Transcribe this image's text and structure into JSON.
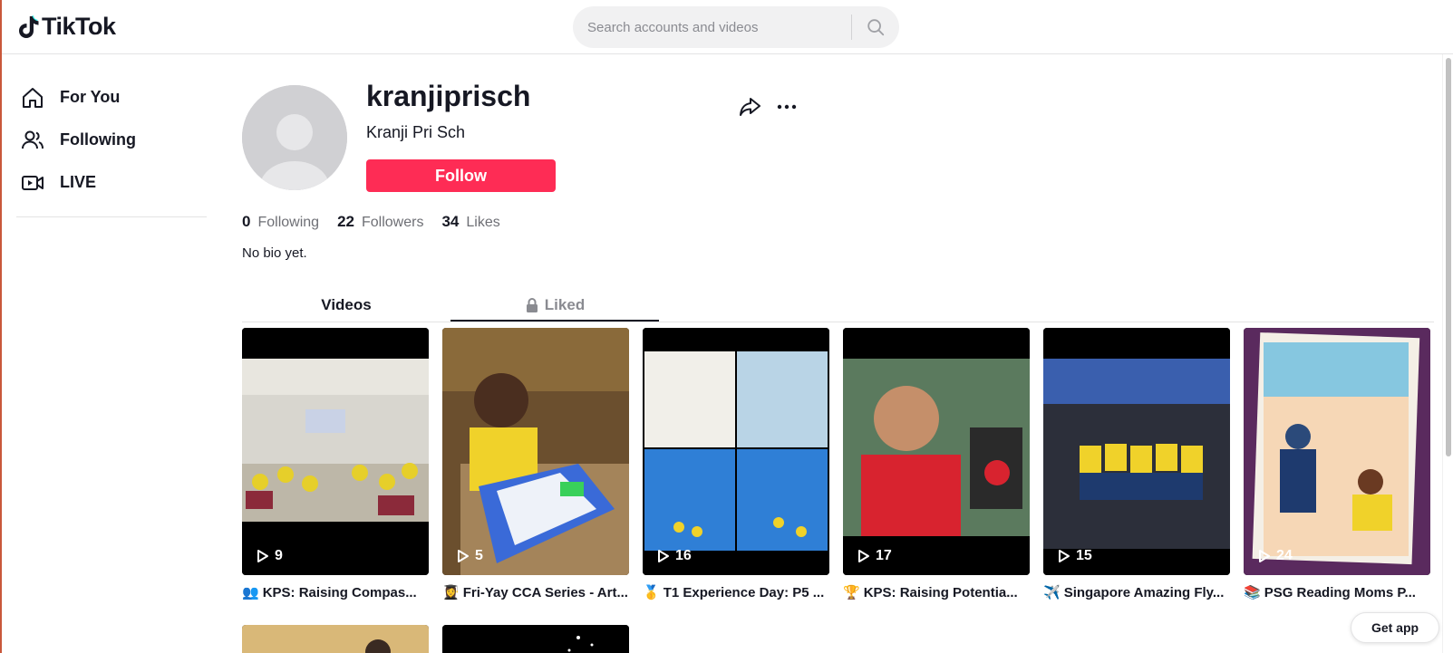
{
  "header": {
    "logo_text": "TikTok",
    "search_placeholder": "Search accounts and videos"
  },
  "sidebar": {
    "items": [
      {
        "label": "For You",
        "icon": "home-icon"
      },
      {
        "label": "Following",
        "icon": "users-icon"
      },
      {
        "label": "LIVE",
        "icon": "live-icon"
      }
    ]
  },
  "profile": {
    "username": "kranjiprisch",
    "nickname": "Kranji Pri Sch",
    "follow_label": "Follow",
    "stats": {
      "following_count": "0",
      "following_label": "Following",
      "followers_count": "22",
      "followers_label": "Followers",
      "likes_count": "34",
      "likes_label": "Likes"
    },
    "bio": "No bio yet."
  },
  "tabs": {
    "videos_label": "Videos",
    "liked_label": "Liked"
  },
  "videos": [
    {
      "views": "9",
      "emoji": "👥",
      "caption": "KPS: Raising Compas..."
    },
    {
      "views": "5",
      "emoji": "👩‍🎓",
      "caption": "Fri-Yay CCA Series - Art..."
    },
    {
      "views": "16",
      "emoji": "🥇",
      "caption": "T1 Experience Day: P5 ..."
    },
    {
      "views": "17",
      "emoji": "🏆",
      "caption": "KPS: Raising Potentia..."
    },
    {
      "views": "15",
      "emoji": "✈️",
      "caption": "Singapore Amazing Fly..."
    },
    {
      "views": "24",
      "emoji": "📚",
      "caption": "PSG Reading Moms P..."
    }
  ],
  "get_app_label": "Get app",
  "colors": {
    "brand_red": "#fe2c55",
    "text_primary": "#161823",
    "text_secondary": "#6e6f75"
  }
}
